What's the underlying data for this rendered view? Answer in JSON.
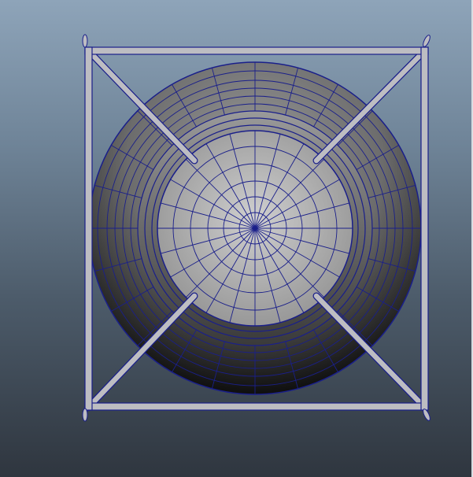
{
  "viewport": {
    "caption": "",
    "background_top": "#8ea4b9",
    "background_bottom": "#2f363f",
    "wireframe_color": "#1a1f8a",
    "object": "cylinder-with-cross-frame"
  }
}
